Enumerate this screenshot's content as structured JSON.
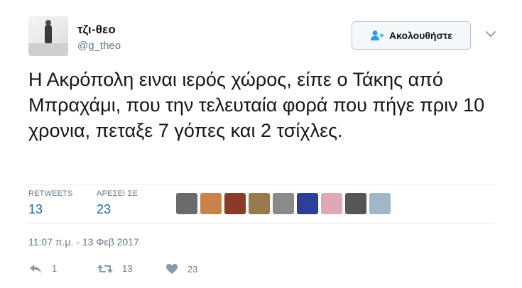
{
  "user": {
    "name": "τζι-θεο",
    "handle": "@g_theo"
  },
  "header": {
    "follow_label": "Ακολουθήστε"
  },
  "tweet": {
    "text": "Η Ακρόπολη ειναι ιερός χώρος, είπε ο Τάκης από Μπραχάμι, που την τελευταία φορά που πήγε πριν 10 χρονια, πεταξε 7 γόπες και 2 τσίχλες.",
    "timestamp": "11:07 π.μ. - 13 Φεβ 2017"
  },
  "stats": {
    "retweets_label": "RETWEETS",
    "retweets_value": "13",
    "likes_label": "ΑΡΕΣΕΙ ΣΕ",
    "likes_value": "23"
  },
  "likers": [
    {
      "name": "liker-1",
      "color": "#6b6b6b"
    },
    {
      "name": "liker-2",
      "color": "#c9834a"
    },
    {
      "name": "liker-3",
      "color": "#8b3a2a"
    },
    {
      "name": "liker-4",
      "color": "#9a7a4a"
    },
    {
      "name": "liker-5",
      "color": "#8a8a8a"
    },
    {
      "name": "liker-6",
      "color": "#2b3f9b"
    },
    {
      "name": "liker-7",
      "color": "#e0a8b4"
    },
    {
      "name": "liker-8",
      "color": "#555555"
    },
    {
      "name": "liker-9",
      "color": "#9fb7c9"
    }
  ],
  "actions": {
    "reply_count": "1",
    "retweet_count": "13",
    "like_count": "23"
  },
  "colors": {
    "link_blue": "#1b6aa5",
    "muted": "#657786",
    "divider": "#e1e8ed"
  }
}
